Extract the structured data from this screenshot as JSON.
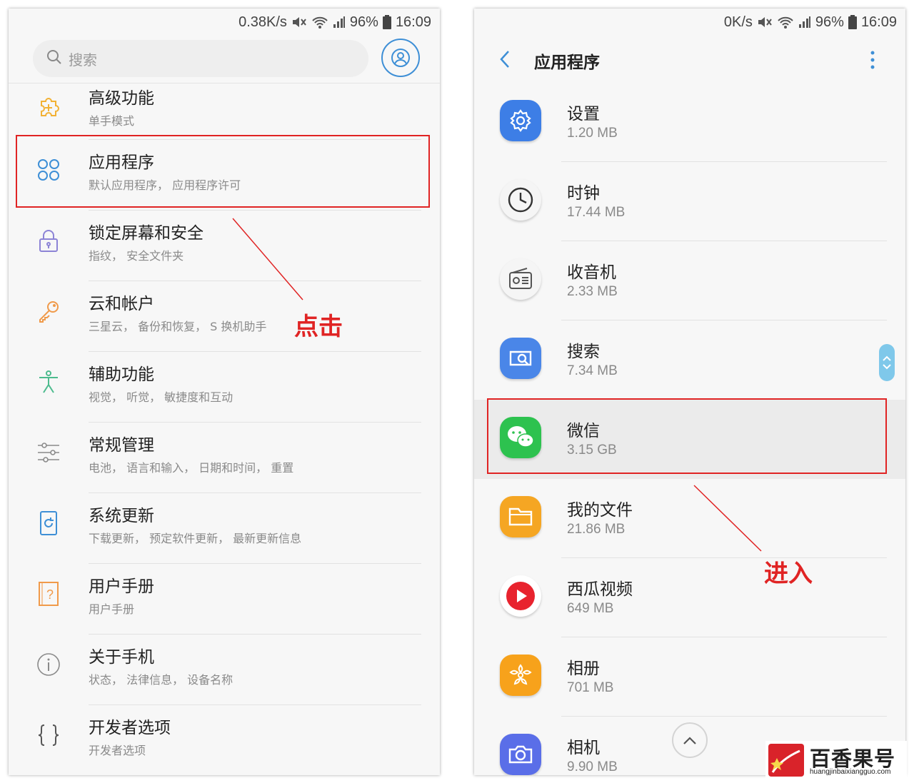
{
  "left": {
    "status": {
      "speed": "0.38K/s",
      "battery": "96%",
      "time": "16:09"
    },
    "search": {
      "placeholder": "搜索"
    },
    "settings": [
      {
        "title": "高级功能",
        "sub": "单手模式",
        "icon": "puzzle-plus-icon"
      },
      {
        "title": "应用程序",
        "sub": "默认应用程序， 应用程序许可",
        "icon": "apps-grid-icon"
      },
      {
        "title": "锁定屏幕和安全",
        "sub": "指纹， 安全文件夹",
        "icon": "lock-icon"
      },
      {
        "title": "云和帐户",
        "sub": "三星云， 备份和恢复， S 换机助手",
        "icon": "key-icon"
      },
      {
        "title": "辅助功能",
        "sub": "视觉， 听觉， 敏捷度和互动",
        "icon": "accessibility-icon"
      },
      {
        "title": "常规管理",
        "sub": "电池， 语言和输入， 日期和时间， 重置",
        "icon": "sliders-icon"
      },
      {
        "title": "系统更新",
        "sub": "下载更新， 预定软件更新， 最新更新信息",
        "icon": "system-update-icon"
      },
      {
        "title": "用户手册",
        "sub": "用户手册",
        "icon": "manual-icon"
      },
      {
        "title": "关于手机",
        "sub": "状态， 法律信息， 设备名称",
        "icon": "info-icon"
      },
      {
        "title": "开发者选项",
        "sub": "开发者选项",
        "icon": "braces-icon"
      }
    ],
    "annotation": "点击"
  },
  "right": {
    "status": {
      "speed": "0K/s",
      "battery": "96%",
      "time": "16:09"
    },
    "title": "应用程序",
    "apps": [
      {
        "name": "设置",
        "size": "1.20 MB",
        "icon": "settings-gear-icon",
        "color": "#3d7ee6"
      },
      {
        "name": "时钟",
        "size": "17.44 MB",
        "icon": "clock-icon",
        "color": "#f5f5f5"
      },
      {
        "name": "收音机",
        "size": "2.33 MB",
        "icon": "radio-icon",
        "color": "#f5f5f5"
      },
      {
        "name": "搜索",
        "size": "7.34 MB",
        "icon": "search-app-icon",
        "color": "#4a86e8"
      },
      {
        "name": "微信",
        "size": "3.15 GB",
        "icon": "wechat-icon",
        "color": "#2dc24f"
      },
      {
        "name": "我的文件",
        "size": "21.86 MB",
        "icon": "folder-icon",
        "color": "#f5a623"
      },
      {
        "name": "西瓜视频",
        "size": "649 MB",
        "icon": "xigua-video-icon",
        "color": "#ffffff"
      },
      {
        "name": "相册",
        "size": "701 MB",
        "icon": "gallery-icon",
        "color": "#f7a21b"
      },
      {
        "name": "相机",
        "size": "9.90 MB",
        "icon": "camera-icon",
        "color": "#5a6ee8"
      }
    ],
    "annotation": "进入"
  },
  "logo": {
    "name": "百香果号",
    "url": "huangjinbaixiangguo.com"
  },
  "colors": {
    "highlight": "#e02424",
    "accent": "#3e8fd6"
  }
}
